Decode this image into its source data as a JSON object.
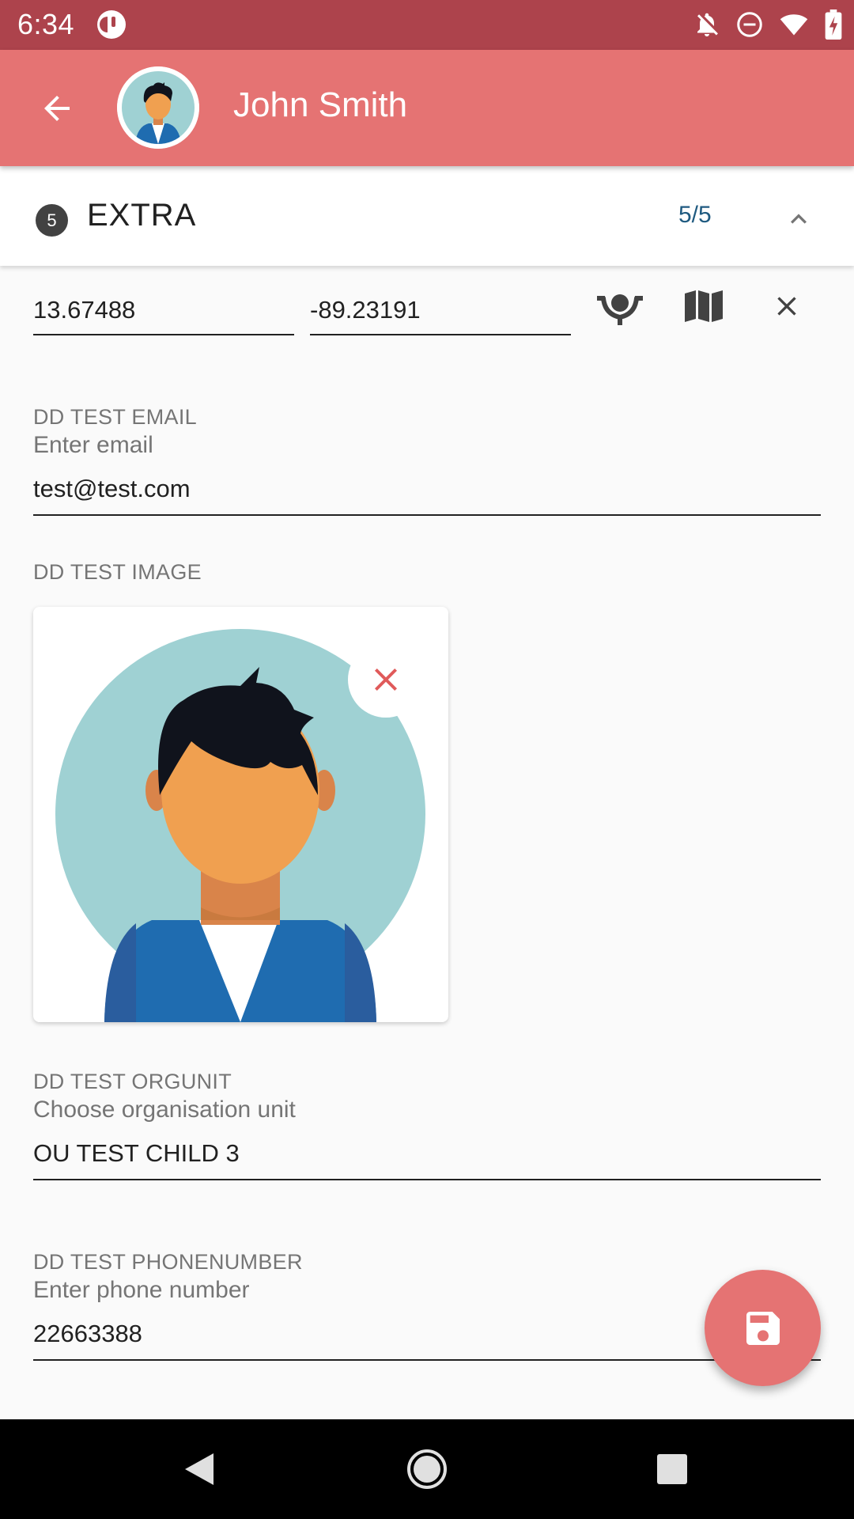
{
  "status_bar": {
    "time": "6:34",
    "icons": [
      "app-notification-icon",
      "notifications-off-icon",
      "do-not-disturb-icon",
      "wifi-icon",
      "battery-charging-icon"
    ]
  },
  "toolbar": {
    "title": "John Smith",
    "back_icon": "arrow-back-icon",
    "color": "#e57373"
  },
  "section": {
    "number": "5",
    "title": "EXTRA",
    "progress": "5/5",
    "toggle_icon": "chevron-up-icon"
  },
  "coordinates": {
    "latitude": "13.67488",
    "longitude": "-89.23191",
    "actions": [
      "gps-location-icon",
      "map-icon",
      "clear-icon"
    ]
  },
  "fields": {
    "email": {
      "label": "DD TEST EMAIL",
      "hint": "Enter email",
      "value": "test@test.com"
    },
    "image": {
      "label": "DD TEST IMAGE",
      "remove_icon": "close-icon"
    },
    "orgunit": {
      "label": "DD TEST ORGUNIT",
      "hint": "Choose organisation unit",
      "value": "OU TEST CHILD 3"
    },
    "phone": {
      "label": "DD TEST PHONENUMBER",
      "hint": "Enter phone number",
      "value": "22663388"
    }
  },
  "fab": {
    "icon": "save-icon"
  },
  "nav_bar": {
    "buttons": [
      "back-triangle-icon",
      "home-circle-icon",
      "recents-square-icon"
    ]
  },
  "colors": {
    "status_bar": "#ad434c",
    "primary": "#e57373",
    "accent_text": "#1f5a80",
    "remove_icon": "#e05a5a"
  }
}
